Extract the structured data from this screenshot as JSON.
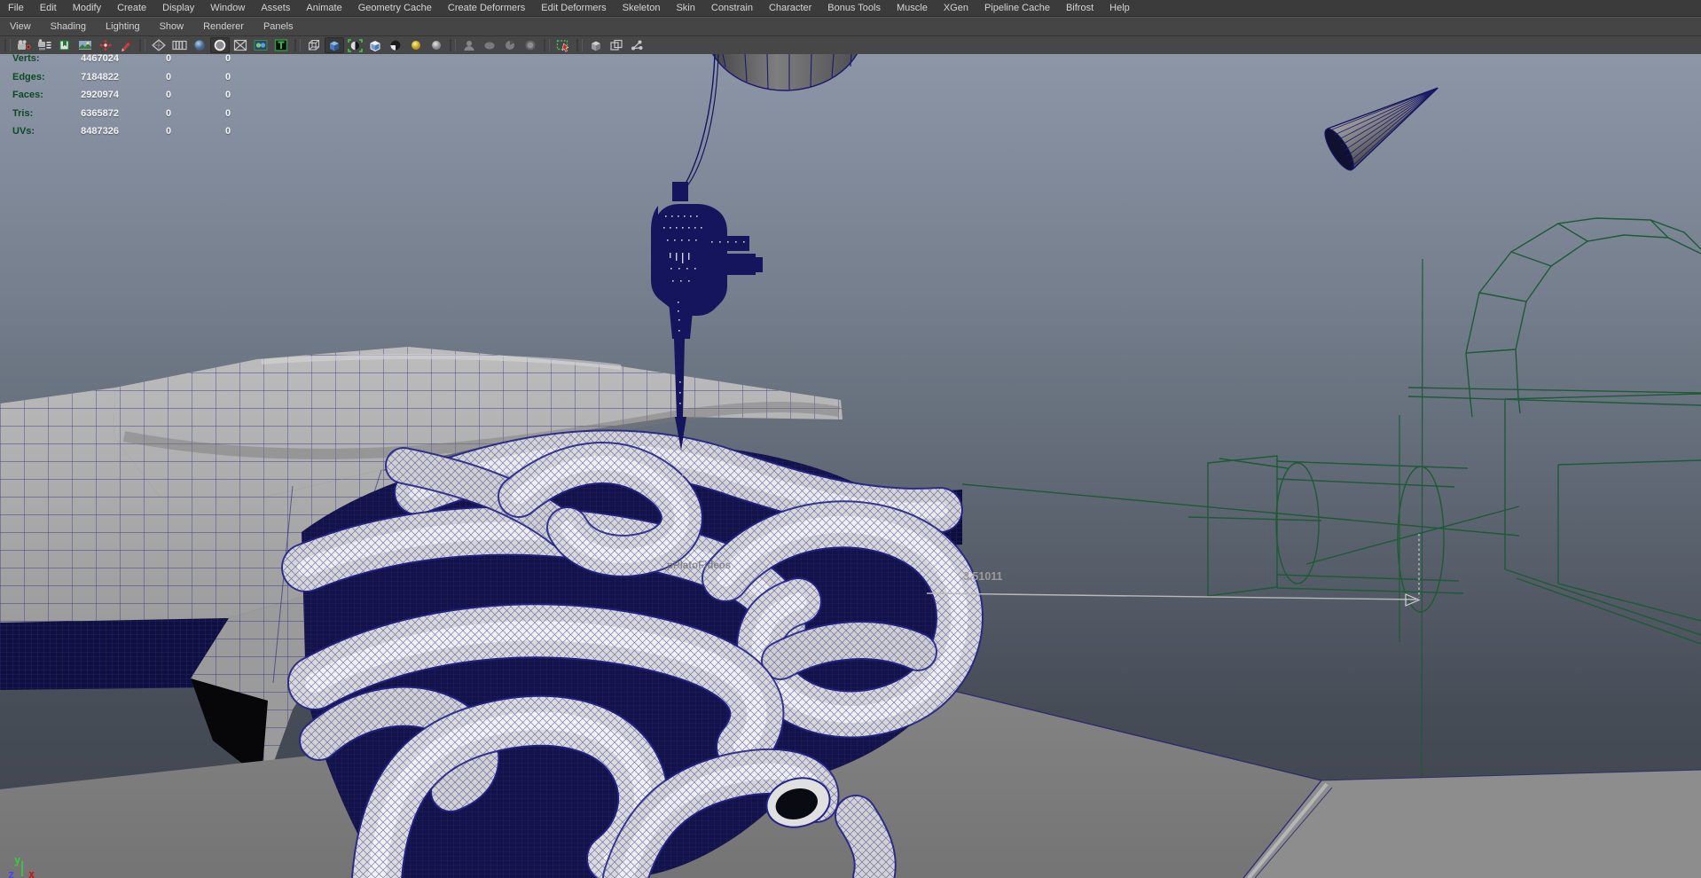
{
  "app": {
    "name": "Maya viewport"
  },
  "menu_bar": {
    "items": [
      "File",
      "Edit",
      "Modify",
      "Create",
      "Display",
      "Window",
      "Assets",
      "Animate",
      "Geometry Cache",
      "Create Deformers",
      "Edit Deformers",
      "Skeleton",
      "Skin",
      "Constrain",
      "Character",
      "Bonus Tools",
      "Muscle",
      "XGen",
      "Pipeline Cache",
      "Bifrost",
      "Help"
    ]
  },
  "panel_menu": {
    "items": [
      "View",
      "Shading",
      "Lighting",
      "Show",
      "Renderer",
      "Panels"
    ]
  },
  "toolbar": {
    "icons": [
      "select-camera-icon",
      "camera-attributes-icon",
      "bookmarks-icon",
      "image-plane-icon",
      "pan-zoom-icon",
      "grease-pencil-icon",
      "wireframe-diamond-icon",
      "film-bars-icon",
      "shaded-sphere-icon",
      "circle-icon",
      "crossed-box-icon",
      "dual-spheres-icon",
      "texture-t-icon",
      "wire-cube-icon",
      "blue-cube-icon",
      "bracket-sphere-icon",
      "outline-cube-icon",
      "checker-sphere-icon",
      "yellow-light-icon",
      "gray-light-icon",
      "ghost-bust-icon",
      "ghost-ellipse-icon",
      "ghost-cut-sphere-icon",
      "ghost-blur-sphere-icon",
      "isolate-select-icon",
      "cube-icon",
      "cube-frame-icon",
      "share-nodes-icon"
    ]
  },
  "hud": {
    "rows": [
      {
        "label": "Verts:",
        "total": "4467024",
        "col2": "0",
        "col3": "0"
      },
      {
        "label": "Edges:",
        "total": "7184822",
        "col2": "0",
        "col3": "0"
      },
      {
        "label": "Faces:",
        "total": "2920974",
        "col2": "0",
        "col3": "0"
      },
      {
        "label": "Tris:",
        "total": "6365872",
        "col2": "0",
        "col3": "0"
      },
      {
        "label": "UVs:",
        "total": "8487326",
        "col2": "0",
        "col3": "0"
      }
    ]
  },
  "viewport": {
    "distance_label": "3.51011",
    "object_label": "pPlatoFideos",
    "axis": {
      "x": "x",
      "y": "y",
      "z": "z"
    }
  },
  "colors": {
    "menu_bg": "#3b3b3b",
    "viewport_top": "#8c96a7",
    "viewport_bottom": "#3e434b",
    "wireframe_blue": "#1c1c8a",
    "dark_mesh_navy": "#15155e",
    "template_green": "#1d5a36",
    "selected_green": "#3fae4e",
    "hud_label_green": "#0d4a22",
    "table_gray": "#7a7a7a",
    "axis_y_green": "#3ecb3e",
    "axis_x_red": "#cc1111",
    "axis_z_blue": "#4444ff"
  }
}
